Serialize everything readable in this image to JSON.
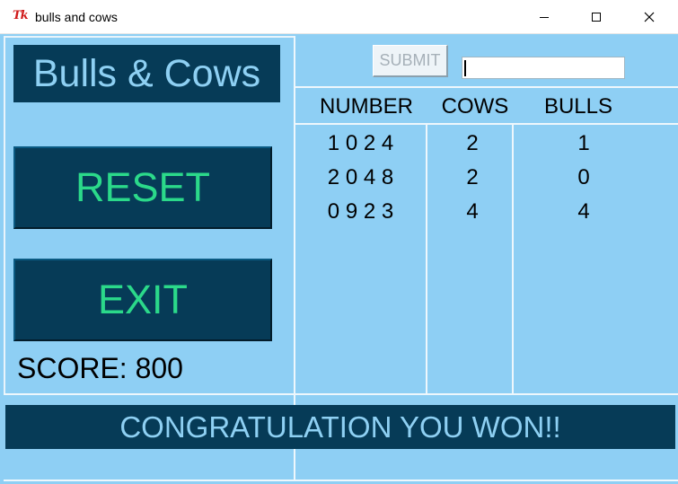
{
  "window": {
    "title": "bulls and cows",
    "icon_label": "Tk"
  },
  "game": {
    "title": "Bulls & Cows",
    "reset_label": "RESET",
    "exit_label": "EXIT",
    "score_label": "SCORE:",
    "score_value": "800",
    "submit_label": "SUBMIT",
    "guess_value": "",
    "status_message": "CONGRATULATION YOU WON!!"
  },
  "table": {
    "headers": [
      "NUMBER",
      "COWS",
      "BULLS"
    ],
    "rows": [
      {
        "number": "1 0 2 4",
        "cows": "2",
        "bulls": "1"
      },
      {
        "number": "2 0 4 8",
        "cows": "2",
        "bulls": "0"
      },
      {
        "number": "0 9 2 3",
        "cows": "4",
        "bulls": "4"
      }
    ]
  },
  "colors": {
    "background": "#8ecff4",
    "panel": "#063b57",
    "button_text": "#2bd98a",
    "title_text": "#8ed0f3"
  }
}
